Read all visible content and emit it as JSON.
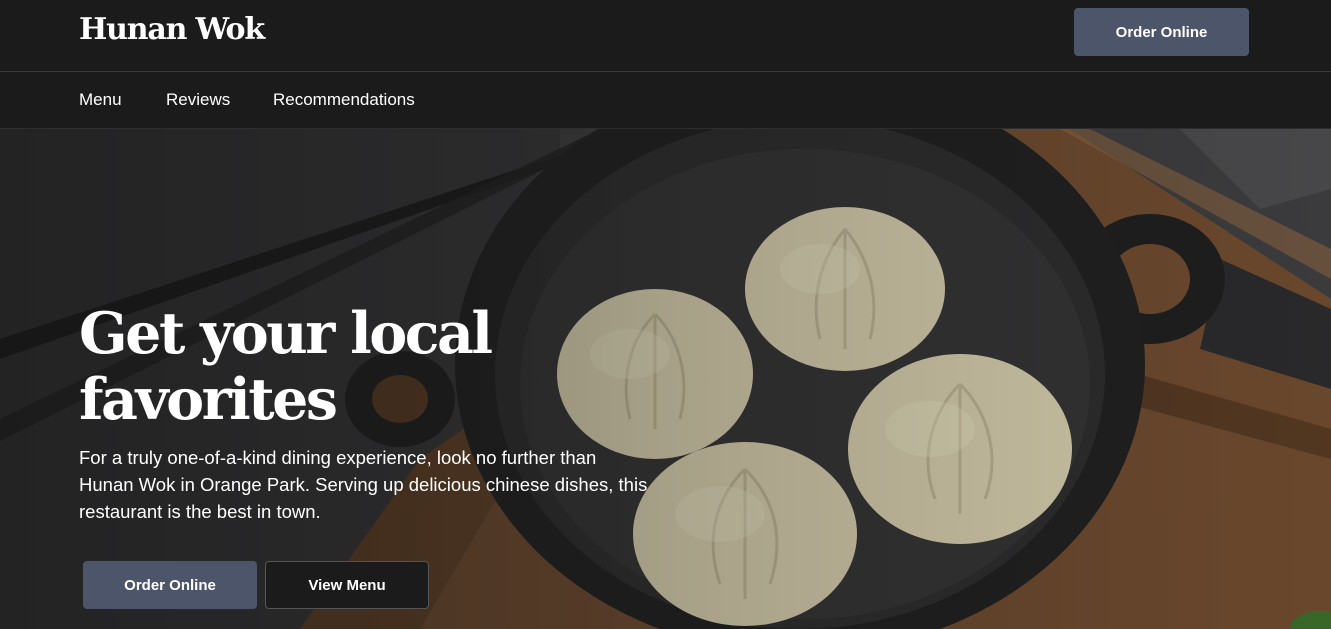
{
  "header": {
    "brand": "Hunan Wok",
    "order_button": "Order Online"
  },
  "nav": {
    "items": [
      "Menu",
      "Reviews",
      "Recommendations"
    ]
  },
  "hero": {
    "title": "Get your local favorites",
    "description": "For a truly one-of-a-kind dining experience, look no further than Hunan Wok in Orange Park. Serving up delicious chinese dishes, this restaurant is the best in town.",
    "primary_button": "Order Online",
    "secondary_button": "View Menu",
    "image": "dumplings-in-cast-iron-pan"
  },
  "colors": {
    "background": "#1c1b1b",
    "accent_button": "#4c5569",
    "text": "#ffffff"
  }
}
